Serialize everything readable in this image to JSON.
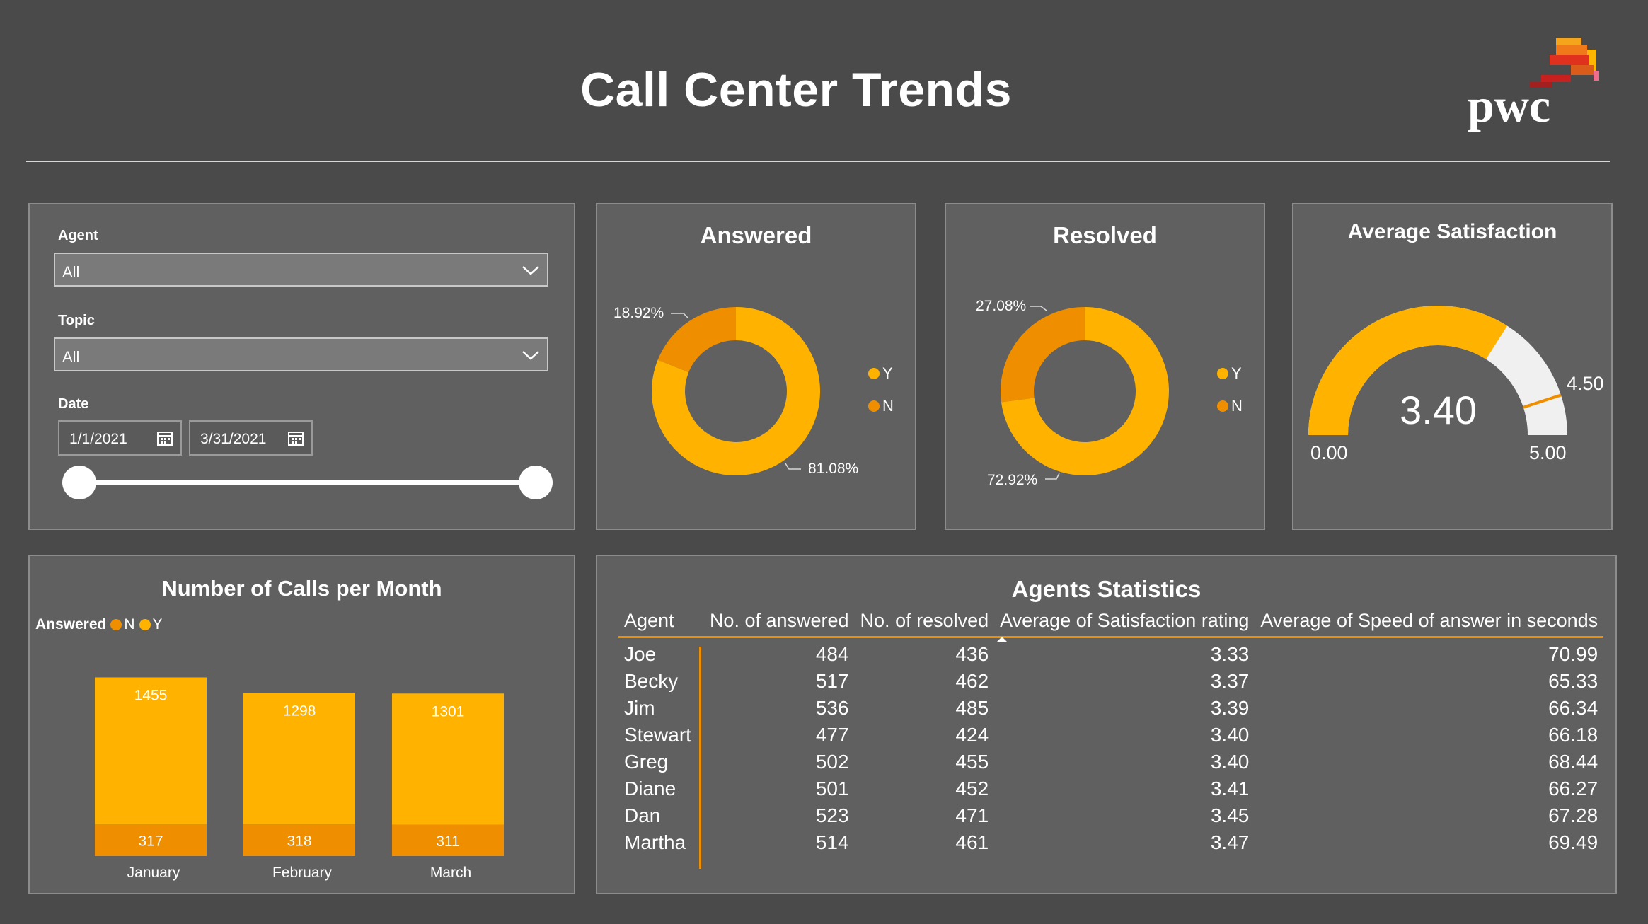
{
  "header": {
    "title": "Call Center Trends",
    "logo_text": "pwc"
  },
  "colors": {
    "y": "#ffb300",
    "n": "#ef8f00",
    "background": "#4a4a4a",
    "panel": "#606060",
    "gauge_remainder": "#f0f0f0"
  },
  "filters": {
    "agent": {
      "label": "Agent",
      "value": "All"
    },
    "topic": {
      "label": "Topic",
      "value": "All"
    },
    "date": {
      "label": "Date",
      "start": "1/1/2021",
      "end": "3/31/2021"
    },
    "icons": {
      "dropdown": "chevron-down-icon",
      "calendar": "calendar-icon"
    }
  },
  "answered": {
    "title": "Answered",
    "y_label": "81.08%",
    "n_label": "18.92%",
    "legend_y": "Y",
    "legend_n": "N"
  },
  "resolved": {
    "title": "Resolved",
    "y_label": "72.92%",
    "n_label": "27.08%",
    "legend_y": "Y",
    "legend_n": "N"
  },
  "satisfaction": {
    "title": "Average Satisfaction",
    "value_label": "3.40",
    "min_label": "0.00",
    "max_label": "5.00",
    "target_label": "4.50"
  },
  "calls": {
    "title": "Number of Calls per Month",
    "legend_title": "Answered",
    "legend_n": "N",
    "legend_y": "Y"
  },
  "agents": {
    "title": "Agents Statistics",
    "columns": [
      "Agent",
      "No. of answered",
      "No. of resolved",
      "Average of Satisfaction rating",
      "Average of Speed of answer in seconds"
    ],
    "rows": [
      [
        "Joe",
        "484",
        "436",
        "3.33",
        "70.99"
      ],
      [
        "Becky",
        "517",
        "462",
        "3.37",
        "65.33"
      ],
      [
        "Jim",
        "536",
        "485",
        "3.39",
        "66.34"
      ],
      [
        "Stewart",
        "477",
        "424",
        "3.40",
        "66.18"
      ],
      [
        "Greg",
        "502",
        "455",
        "3.40",
        "68.44"
      ],
      [
        "Diane",
        "501",
        "452",
        "3.41",
        "66.27"
      ],
      [
        "Dan",
        "523",
        "471",
        "3.45",
        "67.28"
      ],
      [
        "Martha",
        "514",
        "461",
        "3.47",
        "69.49"
      ]
    ]
  },
  "chart_data": [
    {
      "type": "pie",
      "title": "Answered",
      "labels": [
        "Y",
        "N"
      ],
      "values": [
        81.08,
        18.92
      ],
      "donut": true,
      "legend": "right"
    },
    {
      "type": "pie",
      "title": "Resolved",
      "labels": [
        "Y",
        "N"
      ],
      "values": [
        72.92,
        27.08
      ],
      "donut": true,
      "legend": "right"
    },
    {
      "type": "gauge",
      "title": "Average Satisfaction",
      "value": 3.4,
      "min": 0,
      "max": 5,
      "target": 4.5
    },
    {
      "type": "bar",
      "stacked": true,
      "title": "Number of Calls per Month",
      "categories": [
        "January",
        "February",
        "March"
      ],
      "series": [
        {
          "name": "N",
          "values": [
            317,
            318,
            311
          ]
        },
        {
          "name": "Y",
          "values": [
            1455,
            1298,
            1301
          ]
        }
      ],
      "legend": "top-left"
    },
    {
      "type": "table",
      "title": "Agents Statistics",
      "columns": [
        "Agent",
        "No. of answered",
        "No. of resolved",
        "Average of Satisfaction rating",
        "Average of Speed of answer in seconds"
      ],
      "rows": [
        [
          "Joe",
          484,
          436,
          3.33,
          70.99
        ],
        [
          "Becky",
          517,
          462,
          3.37,
          65.33
        ],
        [
          "Jim",
          536,
          485,
          3.39,
          66.34
        ],
        [
          "Stewart",
          477,
          424,
          3.4,
          66.18
        ],
        [
          "Greg",
          502,
          455,
          3.4,
          68.44
        ],
        [
          "Diane",
          501,
          452,
          3.41,
          66.27
        ],
        [
          "Dan",
          523,
          471,
          3.45,
          67.28
        ],
        [
          "Martha",
          514,
          461,
          3.47,
          69.49
        ]
      ],
      "sorted_by": "Average of Satisfaction rating"
    }
  ]
}
